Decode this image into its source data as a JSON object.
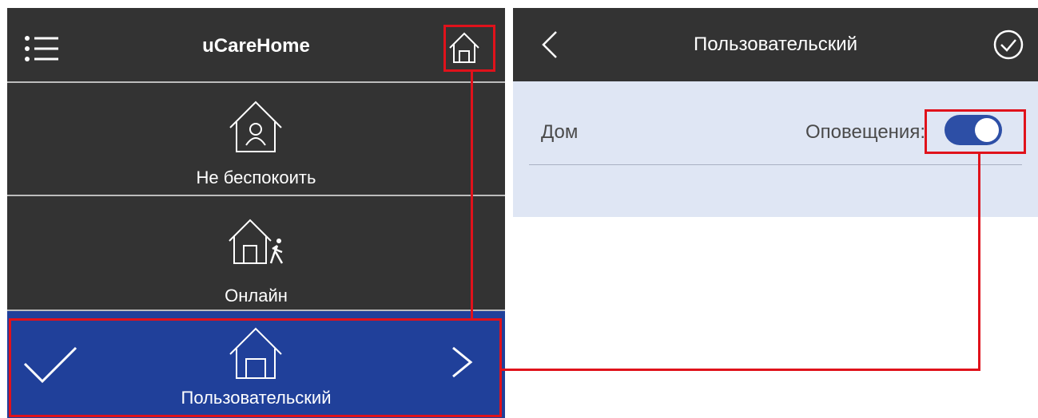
{
  "left": {
    "app_title": "uCareHome",
    "modes": [
      {
        "label": "Не беспокоить",
        "icon": "home-person-icon"
      },
      {
        "label": "Онлайн",
        "icon": "home-walk-icon"
      },
      {
        "label": "Пользовательский",
        "icon": "home-door-icon",
        "selected": true
      }
    ]
  },
  "right": {
    "title": "Пользовательский",
    "row_label": "Дом",
    "notifications_label": "Оповещения:",
    "notifications_on": true
  },
  "colors": {
    "header_bg": "#333333",
    "selected_bg": "#20409a",
    "panel_bg": "#dfe6f4",
    "toggle_on": "#2d4fa6",
    "highlight": "#e0121b"
  }
}
